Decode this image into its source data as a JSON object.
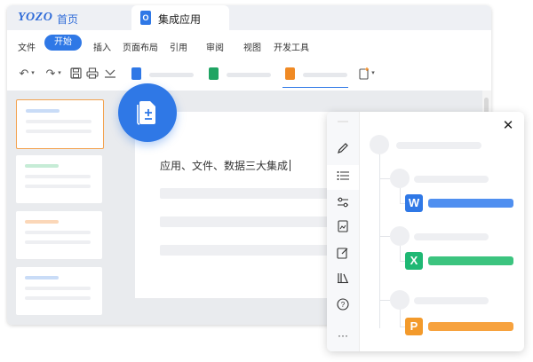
{
  "titlebar": {
    "logo": "YOZO",
    "home": "首页",
    "tab_title": "集成应用",
    "tab_icon_glyph": "O"
  },
  "menu": {
    "items": [
      "文件",
      "开始",
      "插入",
      "页面布局",
      "引用",
      "审阅",
      "视图",
      "开发工具"
    ],
    "active": "开始"
  },
  "toolbar": {
    "icons": [
      "undo-icon",
      "redo-icon",
      "save-icon",
      "print-icon",
      "format-icon"
    ],
    "file_tabs": [
      {
        "color": "#2f78e6",
        "name": "doc-file-icon"
      },
      {
        "color": "#1fa463",
        "name": "sheet-file-icon"
      },
      {
        "color": "#f08a24",
        "name": "ppt-file-icon"
      }
    ]
  },
  "document": {
    "text": "应用、文件、数据三大集成"
  },
  "thumbnails": [
    {
      "accent": "#c9dcf7",
      "selected": true
    },
    {
      "accent": "#c6ecd6",
      "selected": false
    },
    {
      "accent": "#fbd7b8",
      "selected": false
    },
    {
      "accent": "#c9dcf7",
      "selected": false
    }
  ],
  "badge": {
    "icon": "document-add-icon",
    "color": "#2f78e6"
  },
  "panel": {
    "rail_icons": [
      "pen-icon",
      "list-icon",
      "sliders-icon",
      "image-doc-icon",
      "edit-icon",
      "library-icon",
      "help-icon",
      "more-icon"
    ],
    "close_icon": "close-icon",
    "apps": [
      {
        "letter": "W",
        "color": "#2f78e6",
        "bar": "#4f8ff0"
      },
      {
        "letter": "X",
        "color": "#1fb874",
        "bar": "#3cc47f"
      },
      {
        "letter": "P",
        "color": "#f39a2b",
        "bar": "#f7a23e"
      }
    ]
  },
  "colors": {
    "accent": "#2f78e6",
    "selected_thumb_border": "#f3a24f"
  }
}
